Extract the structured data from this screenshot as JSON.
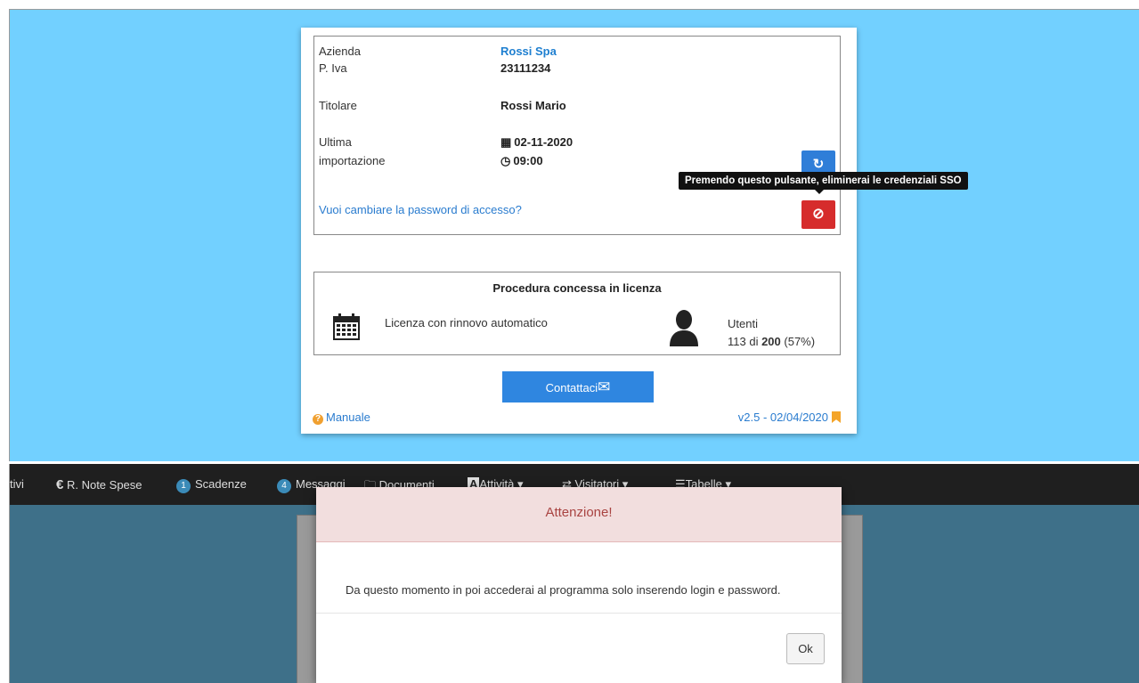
{
  "card": {
    "azienda_label": "Azienda",
    "azienda_value": "Rossi Spa",
    "piva_label": "P. Iva",
    "piva_value": "23111234",
    "titolare_label": "Titolare",
    "titolare_value": "Rossi Mario",
    "ultima_label_1": "Ultima",
    "ultima_label_2": "importazione",
    "ultima_date": "02-11-2020",
    "ultima_time": "09:00",
    "password_link": "Vuoi cambiare la password di accesso?",
    "tooltip": "Premendo questo pulsante, eliminerai le credenziali SSO",
    "license_title": "Procedura concessa in licenza",
    "license_text": "Licenza con rinnovo automatico",
    "utenti_label": "Utenti",
    "utenti_used": "113",
    "utenti_of": " di ",
    "utenti_total": "200",
    "utenti_pct": " (57%)",
    "contact_label": "Contattaci",
    "manual_label": "Manuale",
    "version": "v2.5 - 02/04/2020"
  },
  "navbar": {
    "items": [
      {
        "label": "tivi"
      },
      {
        "label": "R. Note Spese",
        "icon": "euro-icon"
      },
      {
        "label": "Scadenze",
        "badge": "1"
      },
      {
        "label": "Messaggi",
        "badge": "4"
      },
      {
        "label": "Documenti",
        "icon": "folders-icon"
      },
      {
        "label": "Attività ▾",
        "icon": "font-icon"
      },
      {
        "label": "Visitatori ▾",
        "icon": "transfer-icon"
      },
      {
        "label": "Tabelle ▾",
        "icon": "list-icon"
      }
    ]
  },
  "modal": {
    "title": "Attenzione!",
    "body": "Da questo momento in poi accederai al programma solo inserendo login e password.",
    "ok_label": "Ok"
  },
  "colors": {
    "top_bg": "#72d0ff",
    "bottom_bg": "#3e7089",
    "primary": "#2f7ed8",
    "danger": "#d62c2c",
    "modal_header": "#f2dede",
    "modal_title": "#a94442"
  }
}
